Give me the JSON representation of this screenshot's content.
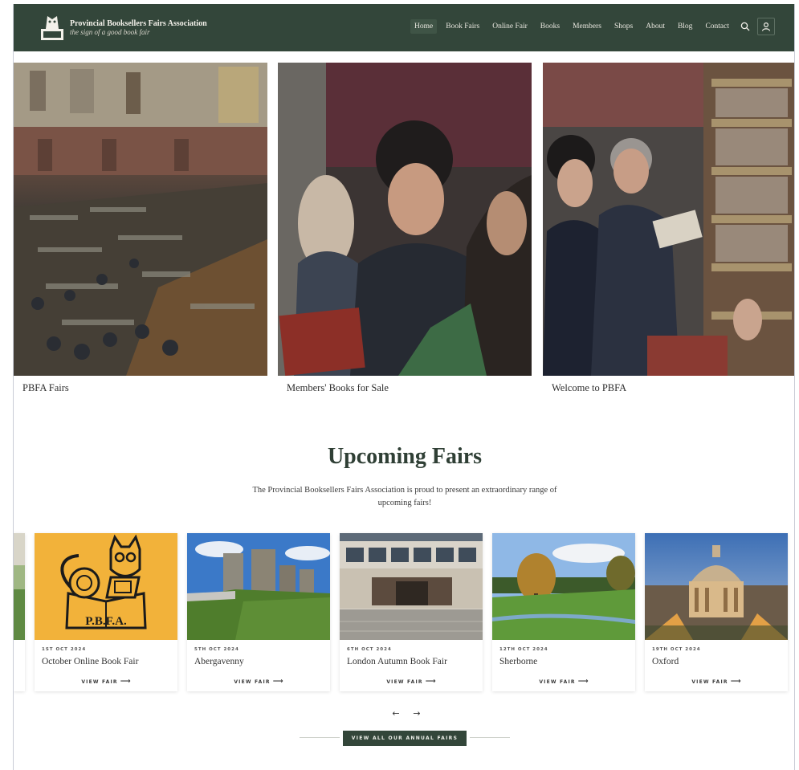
{
  "header": {
    "brand_name": "Provincial Booksellers Fairs Association",
    "brand_tagline": "the sign of a good book fair",
    "nav": [
      {
        "label": "Home",
        "active": true
      },
      {
        "label": "Book Fairs"
      },
      {
        "label": "Online Fair"
      },
      {
        "label": "Books"
      },
      {
        "label": "Members"
      },
      {
        "label": "Shops"
      },
      {
        "label": "About"
      },
      {
        "label": "Blog"
      },
      {
        "label": "Contact"
      }
    ],
    "icons": [
      "search-icon",
      "user-icon"
    ]
  },
  "hero_tiles": [
    {
      "caption": "PBFA Fairs"
    },
    {
      "caption": "Members' Books for Sale"
    },
    {
      "caption": "Welcome to PBFA"
    }
  ],
  "upcoming": {
    "title": "Upcoming Fairs",
    "intro": "The Provincial Booksellers Fairs Association is proud to present an extraordinary range of upcoming fairs!",
    "cards": [
      {
        "date": "1ST OCT 2024",
        "title": "October Online Book Fair",
        "link": "VIEW FAIR"
      },
      {
        "date": "5TH OCT 2024",
        "title": "Abergavenny",
        "link": "VIEW FAIR"
      },
      {
        "date": "6TH OCT 2024",
        "title": "London Autumn Book Fair",
        "link": "VIEW FAIR"
      },
      {
        "date": "12TH OCT 2024",
        "title": "Sherborne",
        "link": "VIEW FAIR"
      },
      {
        "date": "19TH OCT 2024",
        "title": "Oxford",
        "link": "VIEW FAIR"
      }
    ],
    "card_logo_text": "P.B.F.A.",
    "pager": {
      "prev": "←",
      "next": "→"
    },
    "cta": "VIEW ALL OUR ANNUAL FAIRS"
  },
  "colors": {
    "header_bg": "#33463a",
    "accent_green": "#33463a",
    "card_logo_bg": "#f2b23a"
  }
}
